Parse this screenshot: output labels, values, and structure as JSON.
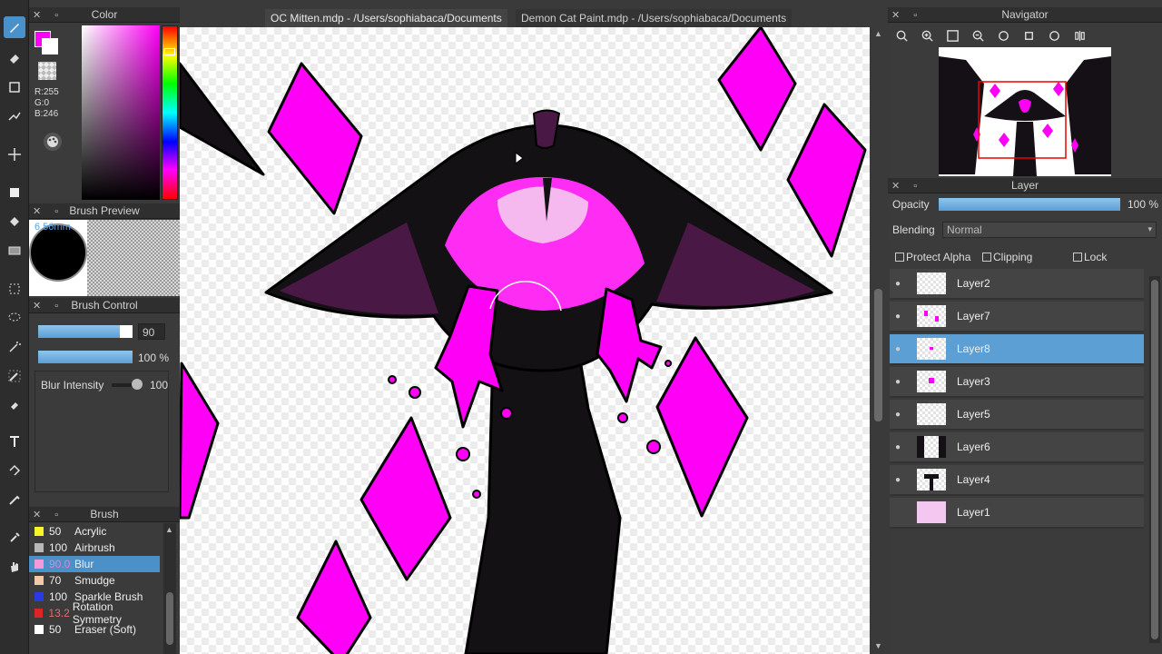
{
  "tabs": [
    {
      "label": "OC Mitten.mdp - /Users/sophiabaca/Documents"
    },
    {
      "label": "Demon Cat Paint.mdp - /Users/sophiabaca/Documents"
    }
  ],
  "color_panel": {
    "title": "Color",
    "r": "R:255",
    "g": "G:0",
    "b": "B:246",
    "foreground": "#ff00f6"
  },
  "brush_preview": {
    "title": "Brush Preview",
    "size": "6.56mm"
  },
  "brush_control": {
    "title": "Brush Control",
    "size_value": "90",
    "opacity_value": "100 %",
    "blur_label": "Blur Intensity",
    "blur_value": "100"
  },
  "brush_list": {
    "title": "Brush",
    "items": [
      {
        "size": "50",
        "name": "Acrylic",
        "color": "#f5f52a"
      },
      {
        "size": "100",
        "name": "Airbrush",
        "color": "#b8b8b8"
      },
      {
        "size": "90.0",
        "name": "Blur",
        "color": "#f59ad8"
      },
      {
        "size": "70",
        "name": "Smudge",
        "color": "#f4c9a8"
      },
      {
        "size": "100",
        "name": "Sparkle Brush",
        "color": "#2b3ae0"
      },
      {
        "size": "13.2",
        "name": "Rotation Symmetry",
        "color": "#e02424"
      },
      {
        "size": "50",
        "name": "Eraser (Soft)",
        "color": "#ffffff"
      }
    ]
  },
  "navigator": {
    "title": "Navigator"
  },
  "layer_panel": {
    "title": "Layer",
    "opacity_label": "Opacity",
    "opacity_value": "100 %",
    "blending_label": "Blending",
    "blending_value": "Normal",
    "protect_alpha": "Protect Alpha",
    "clipping": "Clipping",
    "lock": "Lock",
    "layers": [
      {
        "name": "Layer2"
      },
      {
        "name": "Layer7"
      },
      {
        "name": "Layer8"
      },
      {
        "name": "Layer3"
      },
      {
        "name": "Layer5"
      },
      {
        "name": "Layer6"
      },
      {
        "name": "Layer4"
      },
      {
        "name": "Layer1"
      }
    ]
  }
}
